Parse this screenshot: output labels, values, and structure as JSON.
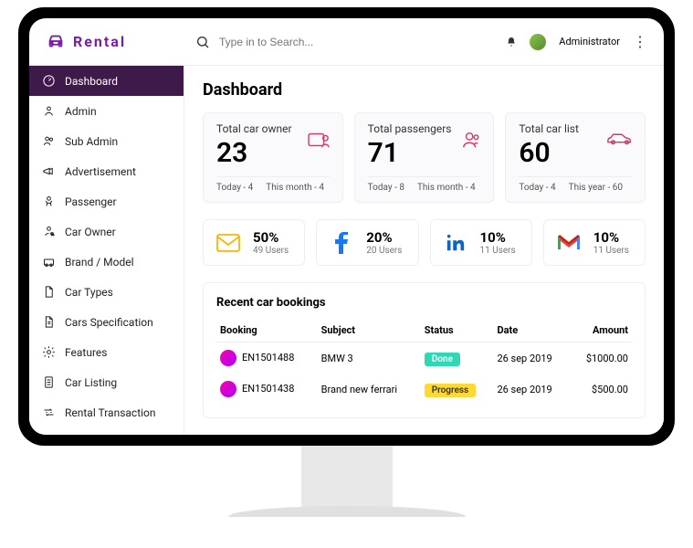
{
  "brand": "Rental",
  "search": {
    "placeholder": "Type in to Search..."
  },
  "user": {
    "role": "Administrator"
  },
  "sidebar": {
    "items": [
      {
        "label": "Dashboard",
        "icon": "dashboard",
        "active": true
      },
      {
        "label": "Admin",
        "icon": "user"
      },
      {
        "label": "Sub Admin",
        "icon": "users"
      },
      {
        "label": "Advertisement",
        "icon": "megaphone"
      },
      {
        "label": "Passenger",
        "icon": "passenger"
      },
      {
        "label": "Car Owner",
        "icon": "carowner"
      },
      {
        "label": "Brand / Model",
        "icon": "brand"
      },
      {
        "label": "Car Types",
        "icon": "doc"
      },
      {
        "label": "Cars Specification",
        "icon": "spec"
      },
      {
        "label": "Features",
        "icon": "gear"
      },
      {
        "label": "Car Listing",
        "icon": "list"
      },
      {
        "label": "Rental Transaction",
        "icon": "transaction"
      }
    ]
  },
  "page_title": "Dashboard",
  "stats": [
    {
      "label": "Total car owner",
      "value": "23",
      "sub1_label": "Today",
      "sub1_val": "4",
      "sub2_label": "This month",
      "sub2_val": "4",
      "icon": "owner"
    },
    {
      "label": "Total passengers",
      "value": "71",
      "sub1_label": "Today",
      "sub1_val": "8",
      "sub2_label": "This month",
      "sub2_val": "4",
      "icon": "passenger"
    },
    {
      "label": "Total car list",
      "value": "60",
      "sub1_label": "Today",
      "sub1_val": "4",
      "sub2_label": "This year",
      "sub2_val": "60",
      "icon": "car"
    }
  ],
  "social": [
    {
      "name": "email",
      "pct": "50%",
      "users": "49 Users",
      "color": "#f5b800"
    },
    {
      "name": "facebook",
      "pct": "20%",
      "users": "20 Users",
      "color": "#1877f2"
    },
    {
      "name": "linkedin",
      "pct": "10%",
      "users": "11 Users",
      "color": "#0a66c2"
    },
    {
      "name": "gmail",
      "pct": "10%",
      "users": "11 Users",
      "color": "#ea4335"
    }
  ],
  "bookings": {
    "title": "Recent car bookings",
    "columns": [
      "Booking",
      "Subject",
      "Status",
      "Date",
      "Amount"
    ],
    "rows": [
      {
        "id": "EN1501488",
        "subject": "BMW 3",
        "status": "Done",
        "status_class": "done",
        "date": "26 sep 2019",
        "amount": "$1000.00"
      },
      {
        "id": "EN1501438",
        "subject": "Brand new ferrari",
        "status": "Progress",
        "status_class": "progress",
        "date": "26 sep 2019",
        "amount": "$500.00"
      }
    ]
  }
}
